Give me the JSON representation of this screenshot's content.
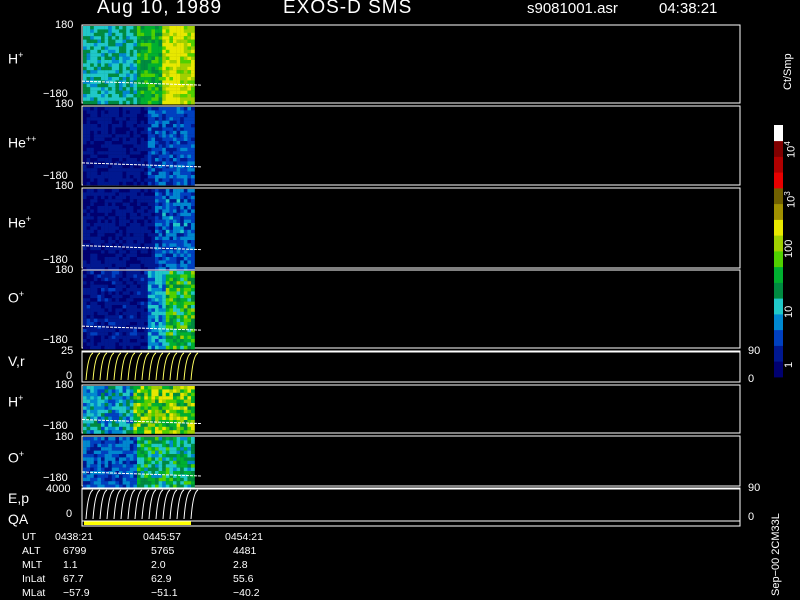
{
  "header": {
    "date": "Aug 10, 1989",
    "instrument": "EXOS-D SMS",
    "file": "s9081001.asr",
    "time": "04:38:21"
  },
  "panels": [
    {
      "id": "h-plus-1",
      "species": "H",
      "charge": "+",
      "ytop": "180",
      "ybottom": "−180"
    },
    {
      "id": "he-plus-plus",
      "species": "He",
      "charge": "++",
      "ytop": "180",
      "ybottom": "−180"
    },
    {
      "id": "he-plus",
      "species": "He",
      "charge": "+",
      "ytop": "180",
      "ybottom": "−180"
    },
    {
      "id": "o-plus-1",
      "species": "O",
      "charge": "+",
      "ytop": "180",
      "ybottom": "−180"
    },
    {
      "id": "vr",
      "label": "V,r",
      "ytop": "25",
      "ybottom": "0",
      "rtop": "90",
      "rbottom": "0"
    },
    {
      "id": "h-plus-2",
      "species": "H",
      "charge": "+",
      "ytop": "180",
      "ybottom": "−180"
    },
    {
      "id": "o-plus-2",
      "species": "O",
      "charge": "+",
      "ytop": "180",
      "ybottom": "−180"
    },
    {
      "id": "ep",
      "label": "E,p",
      "ytop": "4000",
      "ybottom": "0",
      "rtop": "90",
      "rbottom": "0",
      "qa": "QA"
    }
  ],
  "colorbar": {
    "unit": "Ct/Smp",
    "labels": {
      "t1e4": "10",
      "t1e3": "10",
      "t100": "100",
      "t10": "10",
      "t1": "1"
    },
    "exp4": "4",
    "exp3": "3",
    "colors": [
      "#000070",
      "#001890",
      "#0040c0",
      "#0088d0",
      "#20c8c8",
      "#008a40",
      "#00b030",
      "#50d000",
      "#a0d000",
      "#e8e800",
      "#a09000",
      "#706000",
      "#e80000",
      "#b00000",
      "#800000",
      "#ffffff"
    ]
  },
  "time_table": {
    "rows": [
      {
        "label": "UT",
        "values": [
          "0438:21",
          "0445:57",
          "0454:21"
        ]
      },
      {
        "label": "ALT",
        "values": [
          "6799",
          "5765",
          "4481"
        ]
      },
      {
        "label": "MLT",
        "values": [
          "1.1",
          "2.0",
          "2.8"
        ]
      },
      {
        "label": "InLat",
        "values": [
          "67.7",
          "62.9",
          "55.6"
        ]
      },
      {
        "label": "MLat",
        "values": [
          "−57.9",
          "−51.1",
          "−40.2"
        ]
      }
    ]
  },
  "footer_vertical": "Sep−00 2CM33L",
  "chart_data": {
    "type": "heatmap",
    "title": "Aug 10, 1989   EXOS-D SMS",
    "x": [
      "0438:21",
      "0445:57",
      "0454:21"
    ],
    "xlabel": "UT",
    "colorbar_unit": "Ct/Smp",
    "colorbar_range": [
      1,
      10000
    ],
    "panels": [
      {
        "name": "H+",
        "ylim": [
          -180,
          180
        ]
      },
      {
        "name": "He++",
        "ylim": [
          -180,
          180
        ]
      },
      {
        "name": "He+",
        "ylim": [
          -180,
          180
        ]
      },
      {
        "name": "O+",
        "ylim": [
          -180,
          180
        ]
      },
      {
        "name": "V,r",
        "ylim": [
          0,
          25
        ],
        "ylim_right": [
          0,
          90
        ]
      },
      {
        "name": "H+",
        "ylim": [
          -180,
          180
        ]
      },
      {
        "name": "O+",
        "ylim": [
          -180,
          180
        ]
      },
      {
        "name": "E,p",
        "ylim": [
          0,
          4000
        ],
        "ylim_right": [
          0,
          90
        ]
      }
    ],
    "orbit": {
      "ALT": [
        6799,
        5765,
        4481
      ],
      "MLT": [
        1.1,
        2.0,
        2.8
      ],
      "InLat": [
        67.7,
        62.9,
        55.6
      ],
      "MLat": [
        -57.9,
        -51.1,
        -40.2
      ]
    }
  }
}
